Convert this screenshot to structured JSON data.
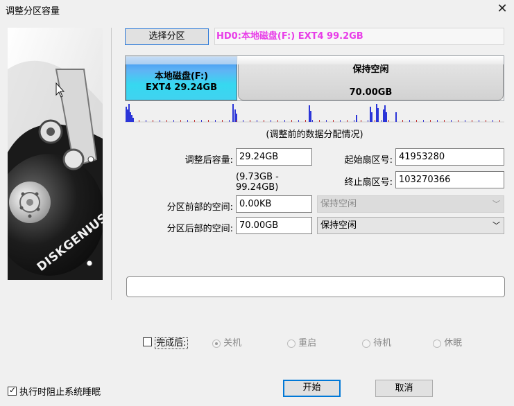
{
  "window": {
    "title": "调整分区容量",
    "close_glyph": "✕"
  },
  "left_image": {
    "brand": "DISKGENIUS"
  },
  "partition": {
    "select_button": "选择分区",
    "info": "HD0:本地磁盘(F:) EXT4 99.2GB"
  },
  "map": {
    "seg1": {
      "name": "本地磁盘(F:)",
      "detail": "EXT4 29.24GB",
      "color": "#3fb9f2"
    },
    "seg2": {
      "name": "保持空闲",
      "size": "70.00GB",
      "color": "#dcdcdc"
    },
    "caption": "(调整前的数据分配情况)"
  },
  "form": {
    "size_label": "调整后容量:",
    "size_value": "29.24GB",
    "range_text": "(9.73GB - 99.24GB)",
    "start_sector_label": "起始扇区号:",
    "start_sector_value": "41953280",
    "end_sector_label": "终止扇区号:",
    "end_sector_value": "103270366",
    "before_label": "分区前部的空间:",
    "before_value": "0.00KB",
    "before_option": "保持空闲",
    "after_label": "分区后部的空间:",
    "after_value": "70.00GB",
    "after_option": "保持空闲"
  },
  "after_done": {
    "label": "完成后:",
    "options": [
      "关机",
      "重启",
      "待机",
      "休眠"
    ],
    "selected": "关机"
  },
  "footer": {
    "prevent_sleep": "执行时阻止系统睡眠",
    "start_button": "开始",
    "cancel_button": "取消"
  }
}
